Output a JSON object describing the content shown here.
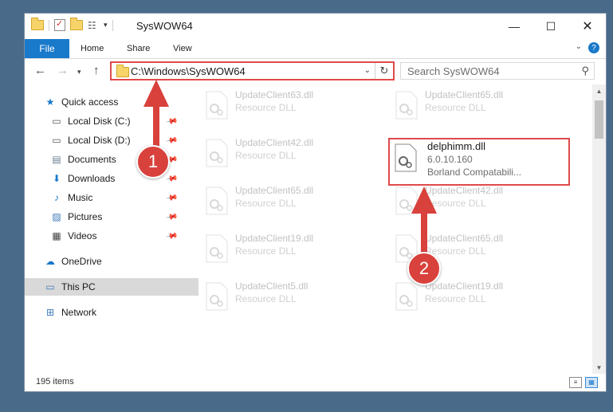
{
  "window": {
    "title": "SysWOW64",
    "min_glyph": "—",
    "max_glyph": "☐",
    "close_glyph": "✕"
  },
  "ribbon": {
    "file": "File",
    "home": "Home",
    "share": "Share",
    "view": "View",
    "help": "?"
  },
  "address": {
    "path": "C:\\Windows\\SysWOW64",
    "search_placeholder": "Search SysWOW64"
  },
  "sidebar": {
    "items": [
      {
        "label": "Quick access",
        "icon": "star-icon",
        "pinned": false
      },
      {
        "label": "Local Disk (C:)",
        "icon": "drive-icon",
        "pinned": true
      },
      {
        "label": "Local Disk (D:)",
        "icon": "drive-icon",
        "pinned": true
      },
      {
        "label": "Documents",
        "icon": "documents-icon",
        "pinned": true
      },
      {
        "label": "Downloads",
        "icon": "download-icon",
        "pinned": true
      },
      {
        "label": "Music",
        "icon": "music-icon",
        "pinned": true
      },
      {
        "label": "Pictures",
        "icon": "pictures-icon",
        "pinned": true
      },
      {
        "label": "Videos",
        "icon": "videos-icon",
        "pinned": true
      },
      {
        "label": "OneDrive",
        "icon": "cloud-icon",
        "pinned": false
      },
      {
        "label": "This PC",
        "icon": "computer-icon",
        "pinned": false,
        "selected": true
      },
      {
        "label": "Network",
        "icon": "network-icon",
        "pinned": false
      }
    ]
  },
  "files": [
    {
      "name": "UpdateClient63.dll",
      "desc": "Resource DLL"
    },
    {
      "name": "UpdateClient65.dll",
      "desc": "Resource DLL"
    },
    {
      "name": "UpdateClient42.dll",
      "desc": "Resource DLL"
    },
    {
      "name": "UpdateClient65.dll",
      "desc": "Resource DLL"
    },
    {
      "name": "UpdateClient42.dll",
      "desc": "Resource DLL"
    },
    {
      "name": "UpdateClient19.dll",
      "desc": "Resource DLL"
    },
    {
      "name": "UpdateClient65.dll",
      "desc": "Resource DLL"
    },
    {
      "name": "UpdateClient5.dll",
      "desc": "Resource DLL"
    },
    {
      "name": "UpdateClient19.dll",
      "desc": "Resource DLL"
    }
  ],
  "highlighted_file": {
    "name": "delphimm.dll",
    "version": "6.0.10.160",
    "company": "Borland Compatabili..."
  },
  "status": {
    "items_count": "195 items"
  },
  "callouts": {
    "step1": "1",
    "step2": "2",
    "color": "#d9413c"
  }
}
